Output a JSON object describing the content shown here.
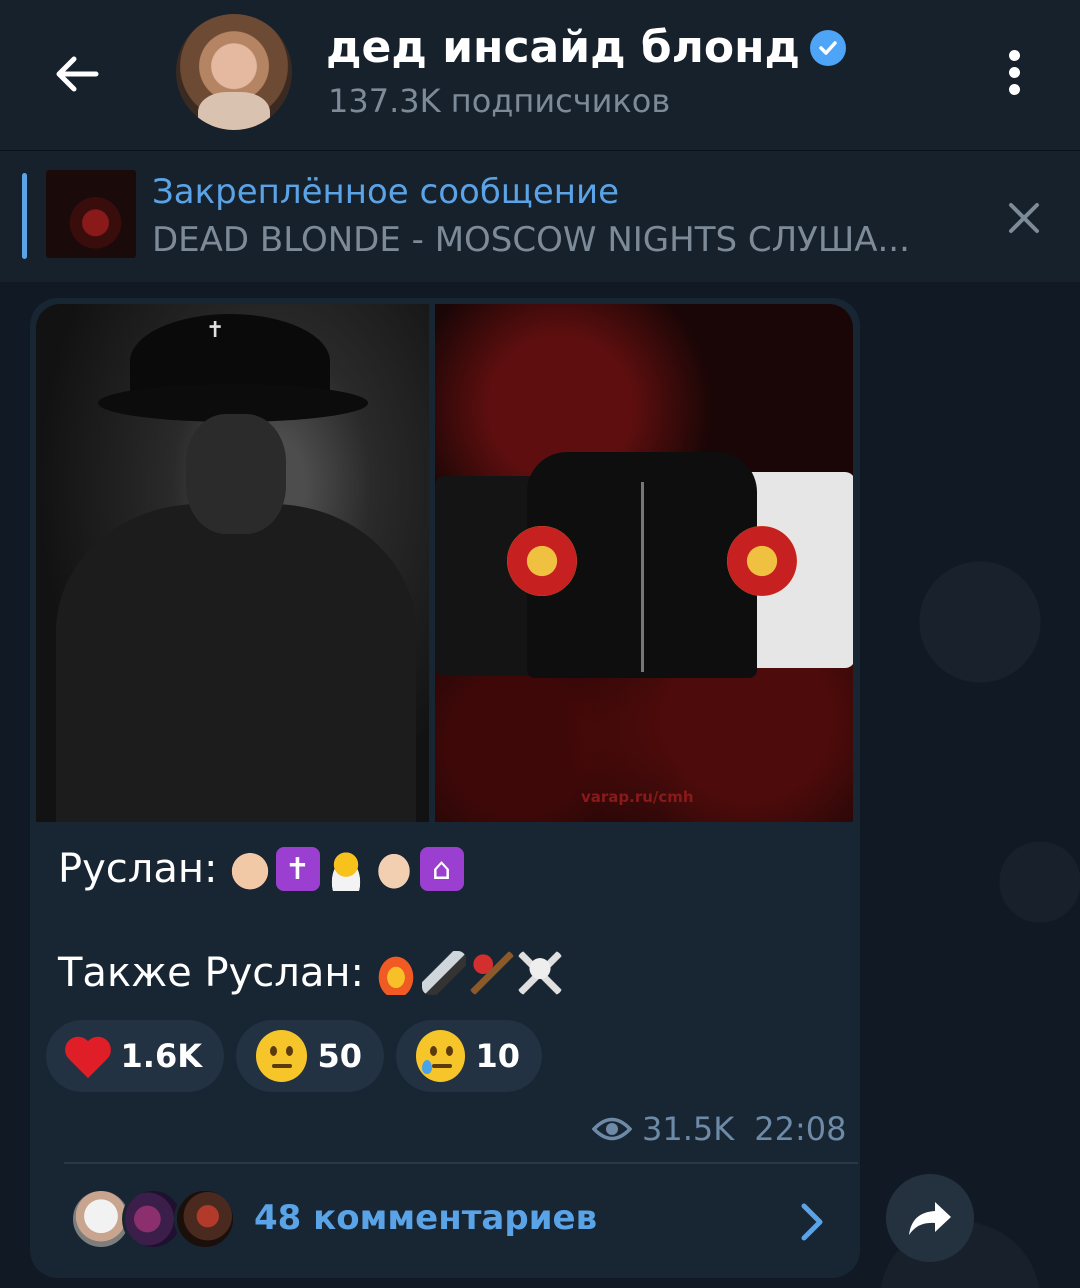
{
  "header": {
    "channel_name": "дед инсайд блонд",
    "subscribers": "137.3K подписчиков",
    "verified": true
  },
  "pinned": {
    "label": "Закреплённое сообщение",
    "text": "DEAD BLONDE - MOSCOW NIGHTS  СЛУША..."
  },
  "message": {
    "photos": [
      {
        "description_icon": "photo-person"
      },
      {
        "description_icon": "photo-merch",
        "watermark": "varap.ru/cmh"
      }
    ],
    "line1_prefix": "Руслан:",
    "line1_emojis": [
      "👼🏻",
      "✝️",
      "🐣",
      "🙏🏻",
      "🛐"
    ],
    "line2_prefix": "Также Руслан:",
    "line2_emojis": [
      "🔥",
      "🔪",
      "🪓",
      "☠️"
    ],
    "reactions": [
      {
        "emoji": "heart",
        "count": "1.6K"
      },
      {
        "emoji": "thinking-face",
        "count": "50"
      },
      {
        "emoji": "crying-face",
        "count": "10"
      }
    ],
    "views": "31.5K",
    "time": "22:08",
    "comments_label": "48 комментариев"
  },
  "colors": {
    "background": "#0e1621",
    "header": "#17212b",
    "bubble": "#182533",
    "accent": "#5aa3e6",
    "muted": "#7d8b99"
  }
}
